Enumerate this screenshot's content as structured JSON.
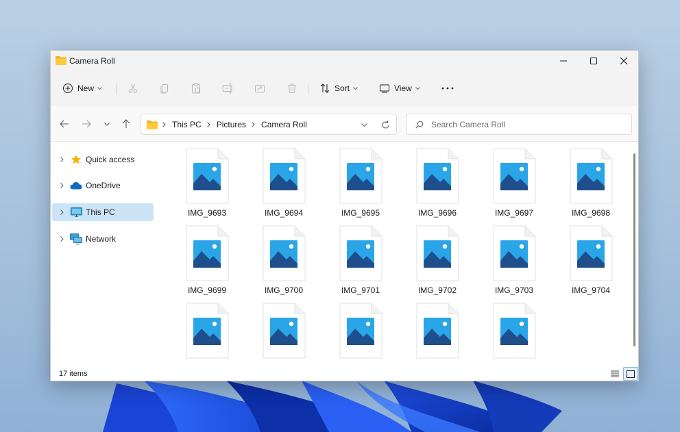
{
  "window": {
    "title": "Camera Roll",
    "title_icon": "folder-icon"
  },
  "titlebar_controls": [
    "minimize-icon",
    "maximize-icon",
    "close-icon"
  ],
  "commandbar": {
    "new_label": "New",
    "sort_label": "Sort",
    "view_label": "View",
    "disabled_icons": [
      "cut-icon",
      "copy-icon",
      "paste-icon",
      "rename-icon",
      "share-icon",
      "delete-icon"
    ],
    "more_icon": "more-options-icon"
  },
  "address": {
    "breadcrumbs": [
      {
        "label": "This PC"
      },
      {
        "label": "Pictures"
      },
      {
        "label": "Camera Roll"
      }
    ]
  },
  "search": {
    "placeholder": "Search Camera Roll",
    "value": ""
  },
  "navpane": {
    "items": [
      {
        "label": "Quick access",
        "icon": "star-icon",
        "selected": false
      },
      {
        "label": "OneDrive",
        "icon": "cloud-icon",
        "selected": false
      },
      {
        "label": "This PC",
        "icon": "monitor-icon",
        "selected": true
      },
      {
        "label": "Network",
        "icon": "network-icon",
        "selected": false
      }
    ]
  },
  "files": [
    {
      "name": "IMG_9693"
    },
    {
      "name": "IMG_9694"
    },
    {
      "name": "IMG_9695"
    },
    {
      "name": "IMG_9696"
    },
    {
      "name": "IMG_9697"
    },
    {
      "name": "IMG_9698"
    },
    {
      "name": "IMG_9699"
    },
    {
      "name": "IMG_9700"
    },
    {
      "name": "IMG_9701"
    },
    {
      "name": "IMG_9702"
    },
    {
      "name": "IMG_9703"
    },
    {
      "name": "IMG_9704"
    },
    {
      "name": ""
    },
    {
      "name": ""
    },
    {
      "name": ""
    },
    {
      "name": ""
    },
    {
      "name": ""
    }
  ],
  "status": {
    "item_count": "17 items"
  },
  "colors": {
    "accent": "#0067c0",
    "selection": "#cce4f7",
    "image_sky": "#2aa6e8",
    "image_mountain": "#1f4e8c"
  }
}
